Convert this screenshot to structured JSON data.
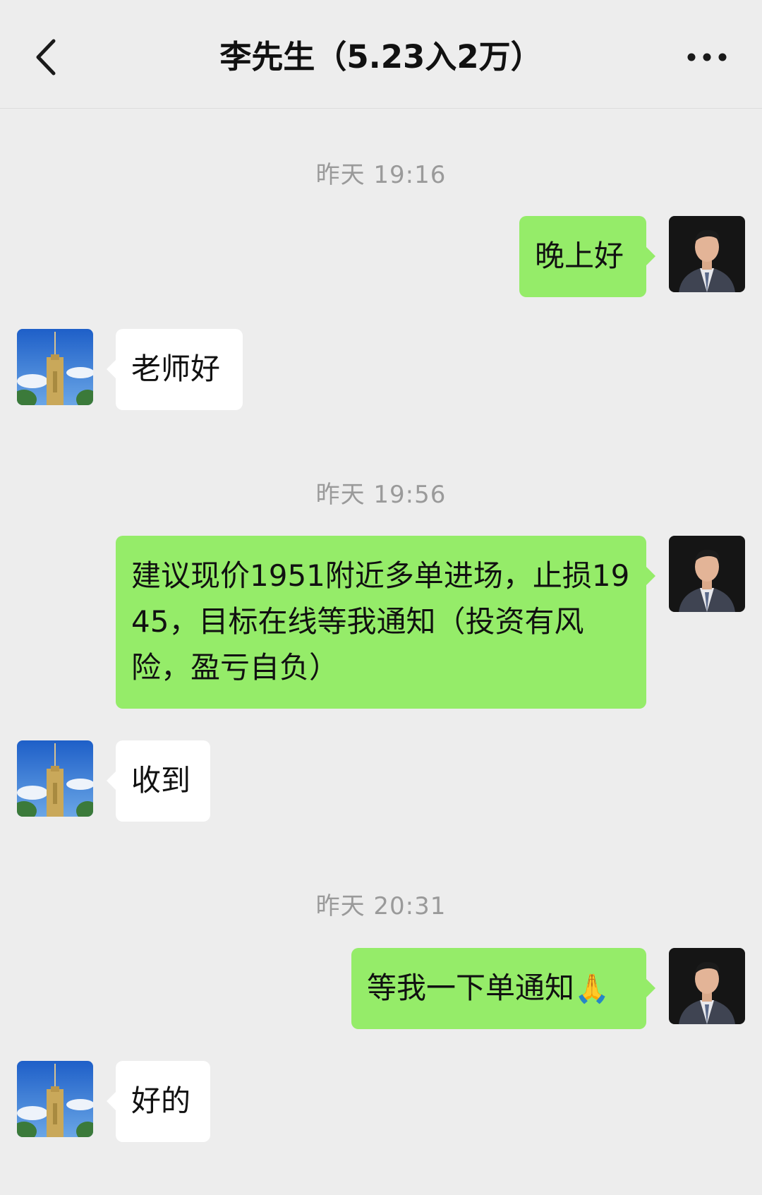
{
  "header": {
    "title": "李先生（5.23入2万）",
    "back_icon": "chevron-left-icon",
    "more_icon": "more-dots-icon"
  },
  "colors": {
    "background": "#ededed",
    "sent_bubble": "#95ec69",
    "received_bubble": "#ffffff",
    "timestamp_text": "#9a9a9a"
  },
  "messages": {
    "ts1": "昨天 19:16",
    "m1": "晚上好",
    "m2": "老师好",
    "ts2": "昨天 19:56",
    "m3": "建议现价1951附近多单进场，止损1945，目标在线等我通知（投资有风险，盈亏自负）",
    "m4": "收到",
    "ts3": "昨天 20:31",
    "m5": "等我一下单通知",
    "m5_emoji": "🙏",
    "m6": "好的"
  }
}
